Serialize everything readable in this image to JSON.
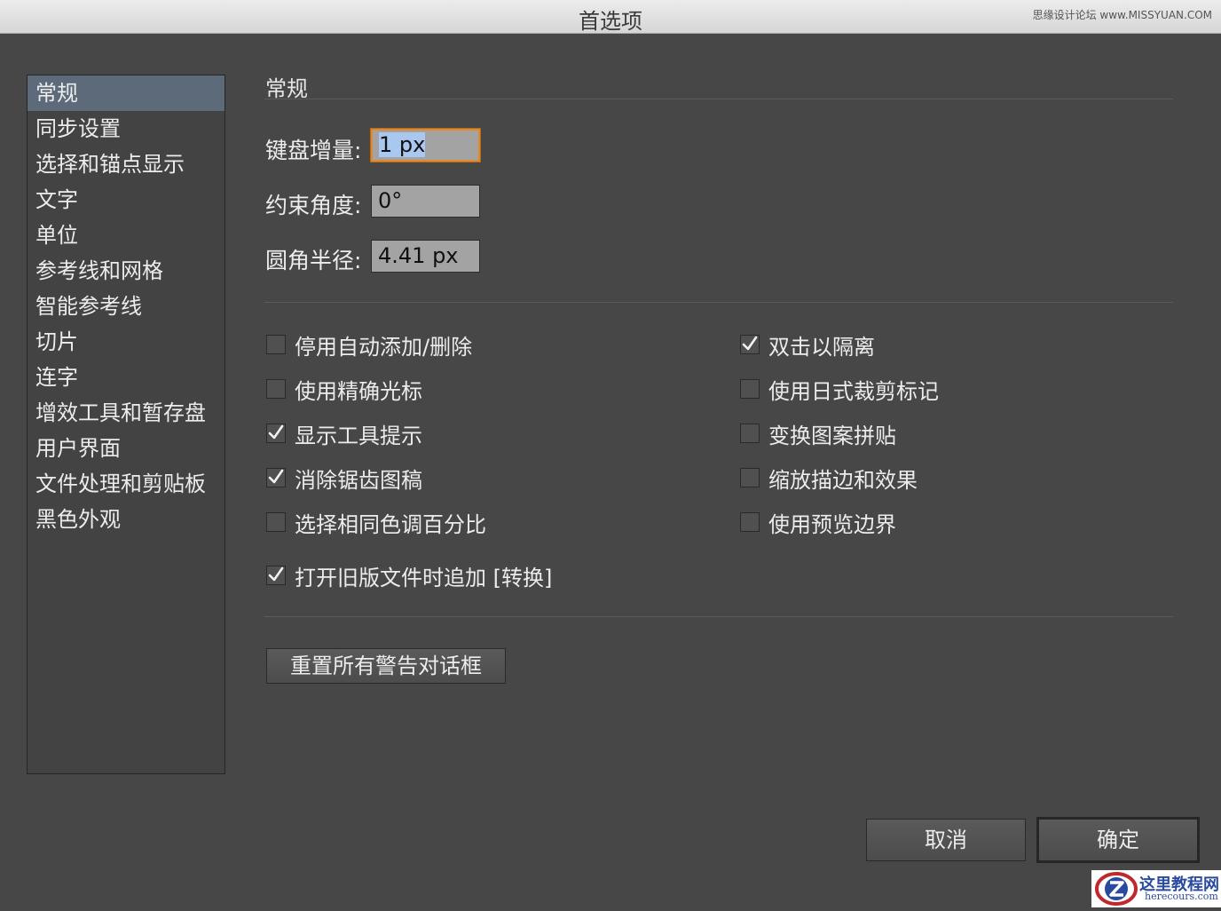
{
  "window": {
    "title": "首选项",
    "watermark": "思缘设计论坛 www.MISSYUAN.COM"
  },
  "sidebar": {
    "items": [
      {
        "label": "常规",
        "selected": true
      },
      {
        "label": "同步设置"
      },
      {
        "label": "选择和锚点显示"
      },
      {
        "label": "文字"
      },
      {
        "label": "单位"
      },
      {
        "label": "参考线和网格"
      },
      {
        "label": "智能参考线"
      },
      {
        "label": "切片"
      },
      {
        "label": "连字"
      },
      {
        "label": "增效工具和暂存盘"
      },
      {
        "label": "用户界面"
      },
      {
        "label": "文件处理和剪贴板"
      },
      {
        "label": "黑色外观"
      }
    ]
  },
  "section": {
    "title": "常规"
  },
  "fields": {
    "keyboard_increment": {
      "label": "键盘增量:",
      "value": "1 px"
    },
    "constrain_angle": {
      "label": "约束角度:",
      "value": "0°"
    },
    "corner_radius": {
      "label": "圆角半径:",
      "value": "4.41 px"
    }
  },
  "options": {
    "disable_auto_add_delete": {
      "label": "停用自动添加/删除",
      "checked": false
    },
    "precise_cursors": {
      "label": "使用精确光标",
      "checked": false
    },
    "show_tool_tips": {
      "label": "显示工具提示",
      "checked": true
    },
    "anti_aliased_artwork": {
      "label": "消除锯齿图稿",
      "checked": true
    },
    "select_same_tint": {
      "label": "选择相同色调百分比",
      "checked": false
    },
    "double_click_isolate": {
      "label": "双击以隔离",
      "checked": true
    },
    "japanese_crop_marks": {
      "label": "使用日式裁剪标记",
      "checked": false
    },
    "transform_pattern_tiles": {
      "label": "变换图案拼贴",
      "checked": false
    },
    "scale_strokes_effects": {
      "label": "缩放描边和效果",
      "checked": false
    },
    "use_preview_bounds": {
      "label": "使用预览边界",
      "checked": false
    },
    "append_converted": {
      "label": "打开旧版文件时追加 [转换]",
      "checked": true
    }
  },
  "buttons": {
    "reset_warnings": "重置所有警告对话框",
    "cancel": "取消",
    "ok": "确定"
  },
  "logo": {
    "name": "这里教程网",
    "url": "herecours.com"
  }
}
